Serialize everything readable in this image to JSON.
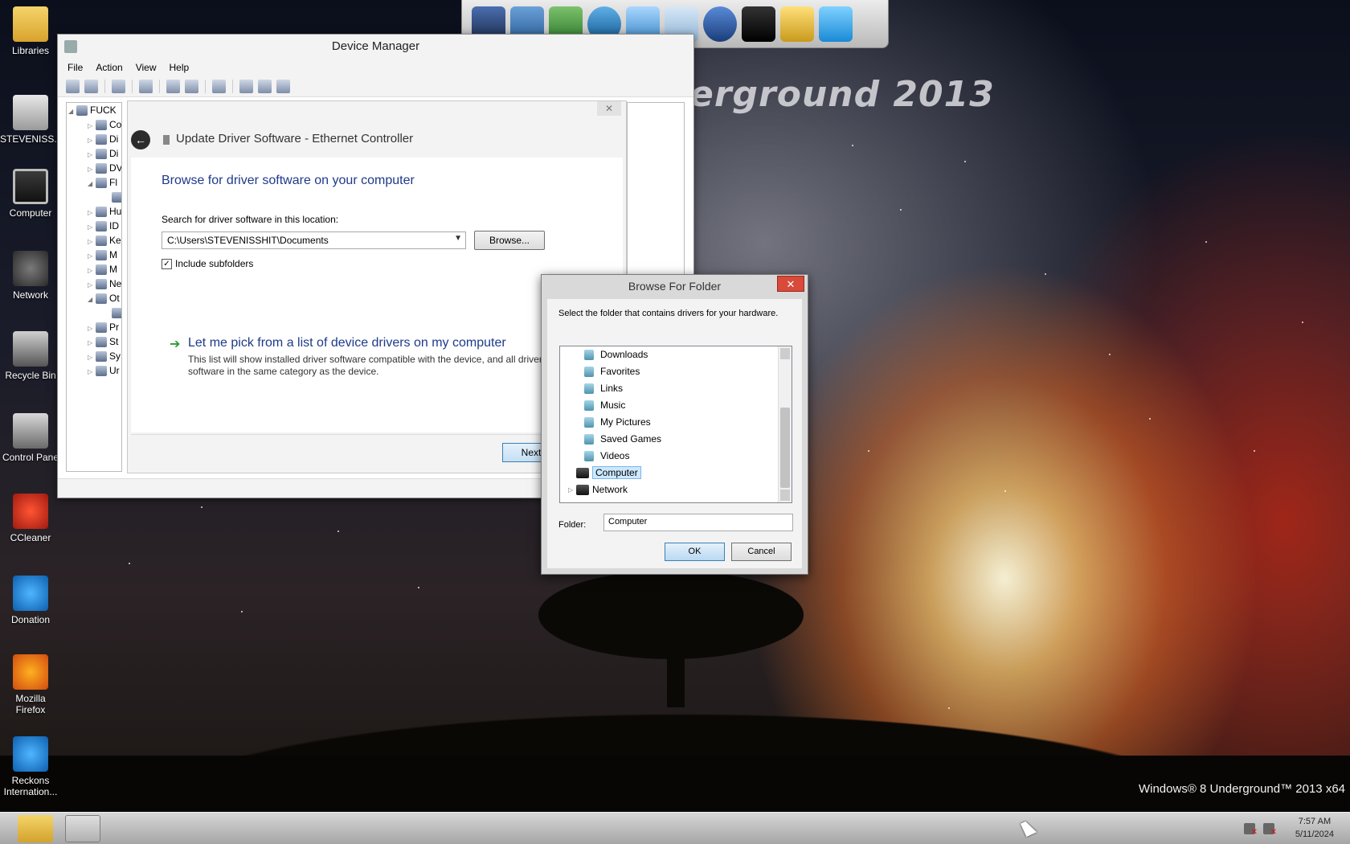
{
  "desktop": {
    "brand_text": "erground 2013",
    "watermark": "Windows® 8 Underground™ 2013 x64",
    "icons": [
      {
        "label": "Libraries",
        "icon": "folder-icon"
      },
      {
        "label": "STEVENISS...",
        "icon": "drive-icon"
      },
      {
        "label": "Computer",
        "icon": "monitor-icon"
      },
      {
        "label": "Network",
        "icon": "network-icon"
      },
      {
        "label": "Recycle Bin",
        "icon": "recycle-bin-icon"
      },
      {
        "label": "Control Pane",
        "icon": "control-panel-icon"
      },
      {
        "label": "CCleaner",
        "icon": "ccleaner-icon"
      },
      {
        "label": "Donation",
        "icon": "ie-icon"
      },
      {
        "label": "Mozilla Firefox",
        "icon": "firefox-icon"
      },
      {
        "label": "Reckons Internation...",
        "icon": "ie-icon"
      }
    ]
  },
  "device_manager": {
    "title": "Device Manager",
    "menu": [
      "File",
      "Action",
      "View",
      "Help"
    ],
    "tree": [
      {
        "label": "FUCK",
        "expander": "◢"
      },
      {
        "label": "Co",
        "expander": "▷"
      },
      {
        "label": "Di",
        "expander": "▷"
      },
      {
        "label": "Di",
        "expander": "▷"
      },
      {
        "label": "DV",
        "expander": "▷"
      },
      {
        "label": "Fl",
        "expander": "◢"
      },
      {
        "label": "",
        "expander": ""
      },
      {
        "label": "Hu",
        "expander": "▷"
      },
      {
        "label": "ID",
        "expander": "▷"
      },
      {
        "label": "Ke",
        "expander": "▷"
      },
      {
        "label": "M",
        "expander": "▷"
      },
      {
        "label": "M",
        "expander": "▷"
      },
      {
        "label": "Ne",
        "expander": "▷"
      },
      {
        "label": "Ot",
        "expander": "◢"
      },
      {
        "label": "",
        "expander": ""
      },
      {
        "label": "Pr",
        "expander": "▷"
      },
      {
        "label": "St",
        "expander": "▷"
      },
      {
        "label": "Sy",
        "expander": "▷"
      },
      {
        "label": "Ur",
        "expander": "▷"
      }
    ]
  },
  "wizard": {
    "title": "Update Driver Software - Ethernet Controller",
    "close": "✕",
    "heading": "Browse for driver software on your computer",
    "search_label": "Search for driver software in this location:",
    "path_value": "C:\\Users\\STEVENISSHIT\\Documents",
    "browse_button": "Browse...",
    "include_subfolders": "Include subfolders",
    "pick_title": "Let me pick from a list of device drivers on my computer",
    "pick_desc": "This list will show installed driver software compatible with the device, and all driver software in the same category as the device.",
    "next_button": "Next"
  },
  "browse_folder": {
    "title": "Browse For Folder",
    "close": "✕",
    "instruction": "Select the folder that contains drivers for your hardware.",
    "items": [
      "Downloads",
      "Favorites",
      "Links",
      "Music",
      "My Pictures",
      "Saved Games",
      "Videos"
    ],
    "selected": "Computer",
    "network": "Network",
    "folder_label": "Folder:",
    "folder_value": "Computer",
    "ok_button": "OK",
    "cancel_button": "Cancel"
  },
  "taskbar": {
    "time": "7:57 AM",
    "date": "5/11/2024"
  }
}
